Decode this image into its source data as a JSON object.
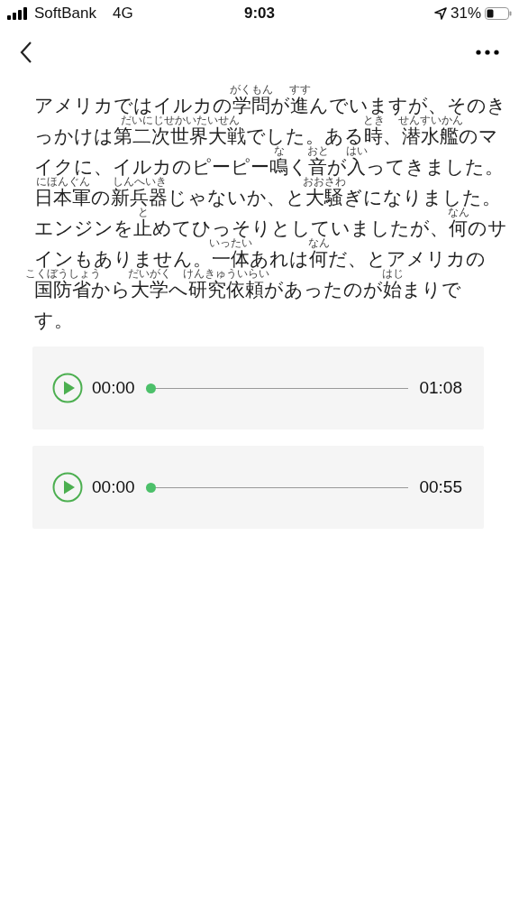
{
  "status_bar": {
    "carrier": "SoftBank",
    "network": "4G",
    "time": "9:03",
    "battery_percent": "31%"
  },
  "article": {
    "lines": [
      [
        {
          "text": "アメリカではイルカの"
        },
        {
          "base": "学問",
          "ruby": "がくもん"
        },
        {
          "text": "が"
        },
        {
          "base": "進",
          "ruby": "すす"
        },
        {
          "text": "んでいますが、そのき"
        }
      ],
      [
        {
          "text": "っかけは"
        },
        {
          "base": "第二次世界大戦",
          "ruby": "だいにじせかいたいせん"
        },
        {
          "text": "でした。ある"
        },
        {
          "base": "時",
          "ruby": "とき"
        },
        {
          "text": "、"
        },
        {
          "base": "潜水艦",
          "ruby": "せんすいかん"
        },
        {
          "text": "のマ"
        }
      ],
      [
        {
          "text": "イクに、イルカのピーピー"
        },
        {
          "base": "鳴",
          "ruby": "な"
        },
        {
          "text": "く"
        },
        {
          "base": "音",
          "ruby": "おと"
        },
        {
          "text": "が"
        },
        {
          "base": "入",
          "ruby": "はい"
        },
        {
          "text": "ってきました。"
        }
      ],
      [
        {
          "base": "日本軍",
          "ruby": "にほんぐん"
        },
        {
          "text": "の"
        },
        {
          "base": "新兵器",
          "ruby": "しんへいき"
        },
        {
          "text": "じゃないか、と"
        },
        {
          "base": "大騒",
          "ruby": "おおさわ"
        },
        {
          "text": "ぎになりました。"
        }
      ],
      [
        {
          "text": "エンジンを"
        },
        {
          "base": "止",
          "ruby": "と"
        },
        {
          "text": "めてひっそりとしていましたが、"
        },
        {
          "base": "何",
          "ruby": "なん"
        },
        {
          "text": "のサ"
        }
      ],
      [
        {
          "text": "インもありません。"
        },
        {
          "base": "一体",
          "ruby": "いったい"
        },
        {
          "text": "あれは"
        },
        {
          "base": "何",
          "ruby": "なん"
        },
        {
          "text": "だ、とアメリカの"
        }
      ],
      [
        {
          "base": "国防省",
          "ruby": "こくぼうしょう"
        },
        {
          "text": "から"
        },
        {
          "base": "大学",
          "ruby": "だいがく"
        },
        {
          "text": "へ"
        },
        {
          "base": "研究依頼",
          "ruby": "けんきゅういらい"
        },
        {
          "text": "があったのが"
        },
        {
          "base": "始",
          "ruby": "はじ"
        },
        {
          "text": "まりで"
        }
      ],
      [
        {
          "text": "す。"
        }
      ]
    ]
  },
  "players": [
    {
      "current_time": "00:00",
      "duration": "01:08",
      "playing": false,
      "level": 0
    },
    {
      "current_time": "00:00",
      "duration": "00:55",
      "playing": false,
      "level": 0
    }
  ]
}
